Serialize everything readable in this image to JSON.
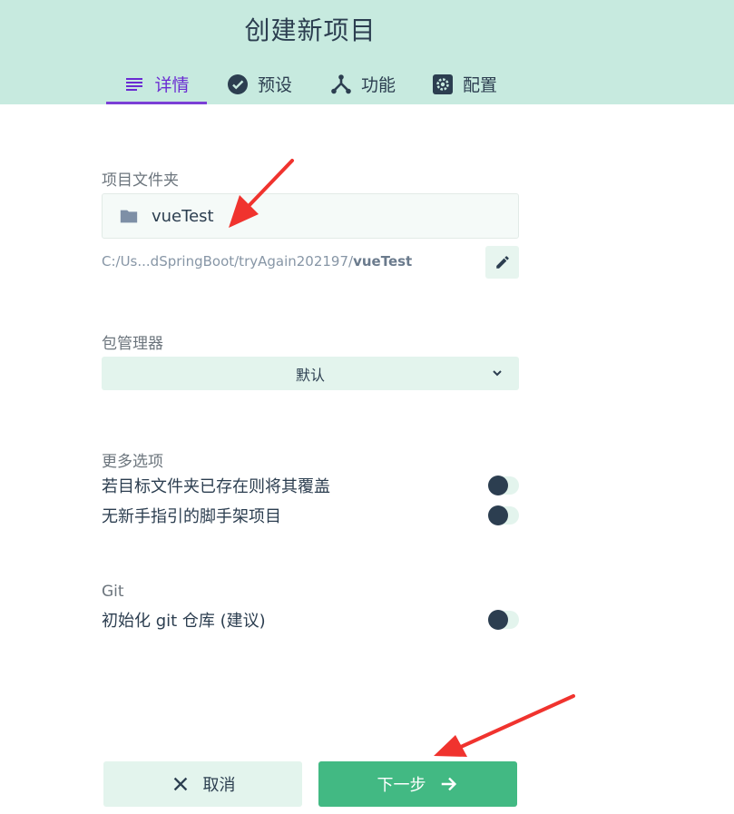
{
  "header": {
    "title": "创建新项目",
    "tabs": [
      {
        "label": "详情",
        "icon": "list-icon",
        "active": true
      },
      {
        "label": "预设",
        "icon": "check-circle-icon",
        "active": false
      },
      {
        "label": "功能",
        "icon": "fork-icon",
        "active": false
      },
      {
        "label": "配置",
        "icon": "gear-icon",
        "active": false
      }
    ]
  },
  "folder": {
    "label": "项目文件夹",
    "name": "vueTest",
    "path_prefix": "C:/Us...dSpringBoot/tryAgain202197/",
    "path_name": "vueTest"
  },
  "package_manager": {
    "label": "包管理器",
    "selected": "默认"
  },
  "more_options": {
    "label": "更多选项",
    "items": [
      {
        "text": "若目标文件夹已存在则将其覆盖",
        "enabled": false
      },
      {
        "text": "无新手指引的脚手架项目",
        "enabled": false
      }
    ]
  },
  "git": {
    "label": "Git",
    "items": [
      {
        "text": "初始化 git 仓库 (建议)",
        "enabled": false
      }
    ]
  },
  "buttons": {
    "cancel": "取消",
    "next": "下一步"
  },
  "colors": {
    "header_bg": "#c7eadf",
    "accent_purple": "#6a2bd2",
    "primary_green": "#42b983",
    "text_dark": "#2c3e50",
    "annotation_red": "#f0332e"
  }
}
